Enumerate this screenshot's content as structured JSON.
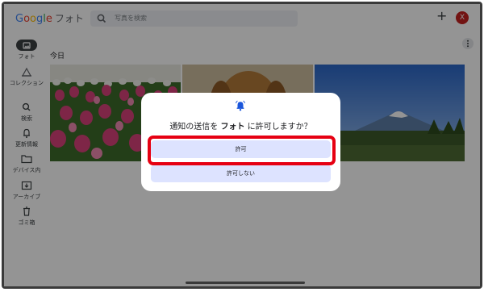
{
  "app": {
    "logo_parts": [
      "G",
      "o",
      "o",
      "g",
      "l",
      "e"
    ],
    "name": "フォト"
  },
  "search": {
    "placeholder": "写真を検索"
  },
  "header": {
    "add_label": "+",
    "avatar_letter": "X"
  },
  "sidebar": {
    "items": [
      {
        "label": "フォト",
        "icon": "photos-icon"
      },
      {
        "label": "コレクション",
        "icon": "collections-icon"
      },
      {
        "label": "検索",
        "icon": "search-icon"
      },
      {
        "label": "更新情報",
        "icon": "bell-icon"
      },
      {
        "label": "デバイス内",
        "icon": "folder-icon"
      },
      {
        "label": "アーカイブ",
        "icon": "archive-icon"
      },
      {
        "label": "ゴミ箱",
        "icon": "trash-icon"
      }
    ]
  },
  "main": {
    "section_title": "今日"
  },
  "dialog": {
    "title_prefix": "通知の送信を ",
    "title_app": "フォト",
    "title_suffix": " に許可しますか？",
    "allow_label": "許可",
    "deny_label": "許可しない"
  },
  "colors": {
    "highlight": "#e60012",
    "button_bg": "#dde3ff",
    "bell": "#1a56db",
    "avatar": "#c5221f"
  }
}
